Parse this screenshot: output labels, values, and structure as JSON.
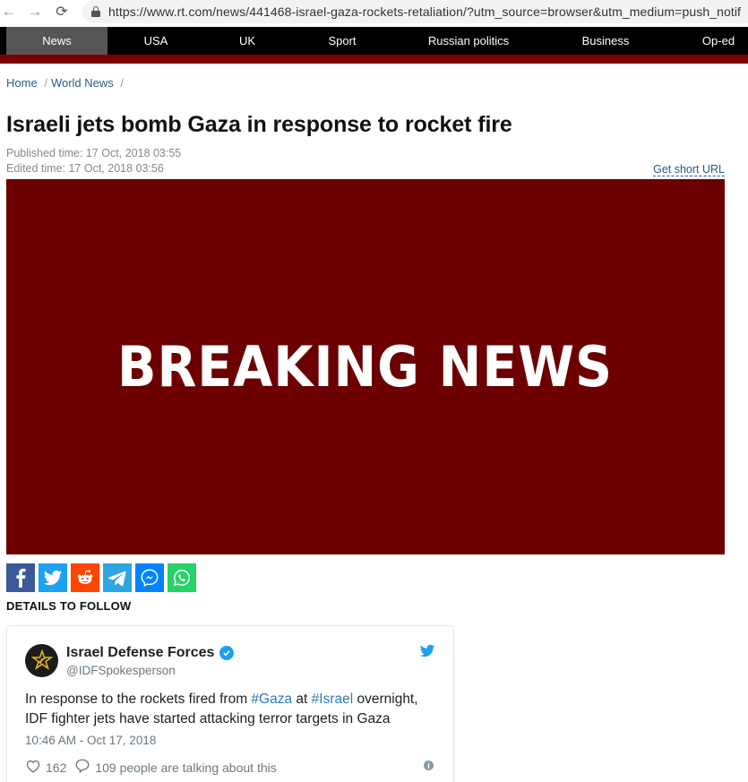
{
  "browser": {
    "url": "https://www.rt.com/news/441468-israel-gaza-rockets-retaliation/?utm_source=browser&utm_medium=push_notif"
  },
  "nav": {
    "items": [
      {
        "label": "News",
        "active": true
      },
      {
        "label": "USA"
      },
      {
        "label": "UK"
      },
      {
        "label": "Sport"
      },
      {
        "label": "Russian politics"
      },
      {
        "label": "Business"
      },
      {
        "label": "Op-ed"
      }
    ]
  },
  "breadcrumb": {
    "home": "Home",
    "section": "World News",
    "sep": "/"
  },
  "article": {
    "title": "Israeli jets bomb Gaza in response to rocket fire",
    "published": "Published time: 17 Oct, 2018 03:55",
    "edited": "Edited time: 17 Oct, 2018 03:56",
    "short_url_label": "Get short URL",
    "hero_text": "BREAKING NEWS",
    "details": "DETAILS TO FOLLOW"
  },
  "share": {
    "buttons": [
      {
        "name": "facebook",
        "color": "#3b5998"
      },
      {
        "name": "twitter",
        "color": "#1da1f2"
      },
      {
        "name": "reddit",
        "color": "#ff4500"
      },
      {
        "name": "telegram",
        "color": "#2ca5e0"
      },
      {
        "name": "messenger",
        "color": "#0084ff"
      },
      {
        "name": "whatsapp",
        "color": "#25d366"
      }
    ]
  },
  "tweet": {
    "author": "Israel Defense Forces",
    "handle": "@IDFSpokesperson",
    "text_1": "In response to the rockets fired from ",
    "tag_1": "#Gaza",
    "text_2": " at ",
    "tag_2": "#Israel",
    "text_3": " overnight, IDF fighter jets have started attacking terror targets in Gaza",
    "time": "10:46 AM - Oct 17, 2018",
    "likes": "162",
    "talking": "109 people are talking about this"
  },
  "colors": {
    "hero_bg": "#6c0000",
    "accent_red": "#7b0000",
    "link": "#2a5a8a",
    "twitter_blue": "#1da1f2"
  }
}
